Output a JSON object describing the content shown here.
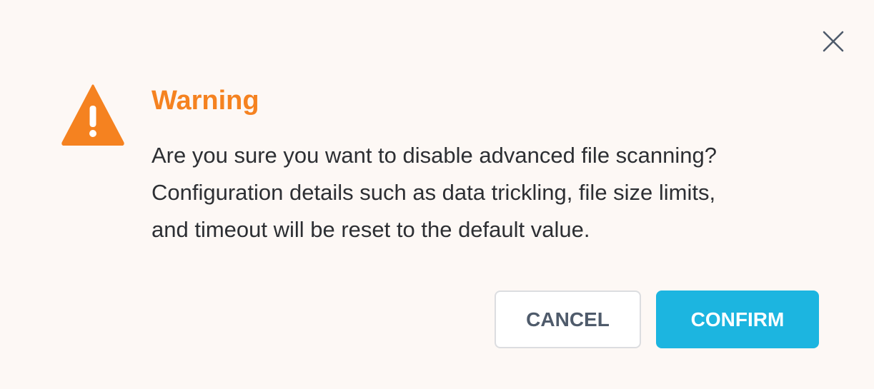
{
  "dialog": {
    "title": "Warning",
    "message_lines": [
      "Are you sure you want to disable advanced file scanning?",
      "Configuration details such as data trickling, file size limits,",
      "and timeout will be reset to the default value."
    ],
    "cancel_label": "CANCEL",
    "confirm_label": "CONFIRM",
    "close_icon": "close-icon",
    "warning_icon": "warning-triangle-icon"
  },
  "colors": {
    "background": "#fdf8f5",
    "warning": "#f58220",
    "confirm": "#1cb5e0",
    "text": "#2d2f33",
    "cancel_text": "#4f5b6b"
  }
}
